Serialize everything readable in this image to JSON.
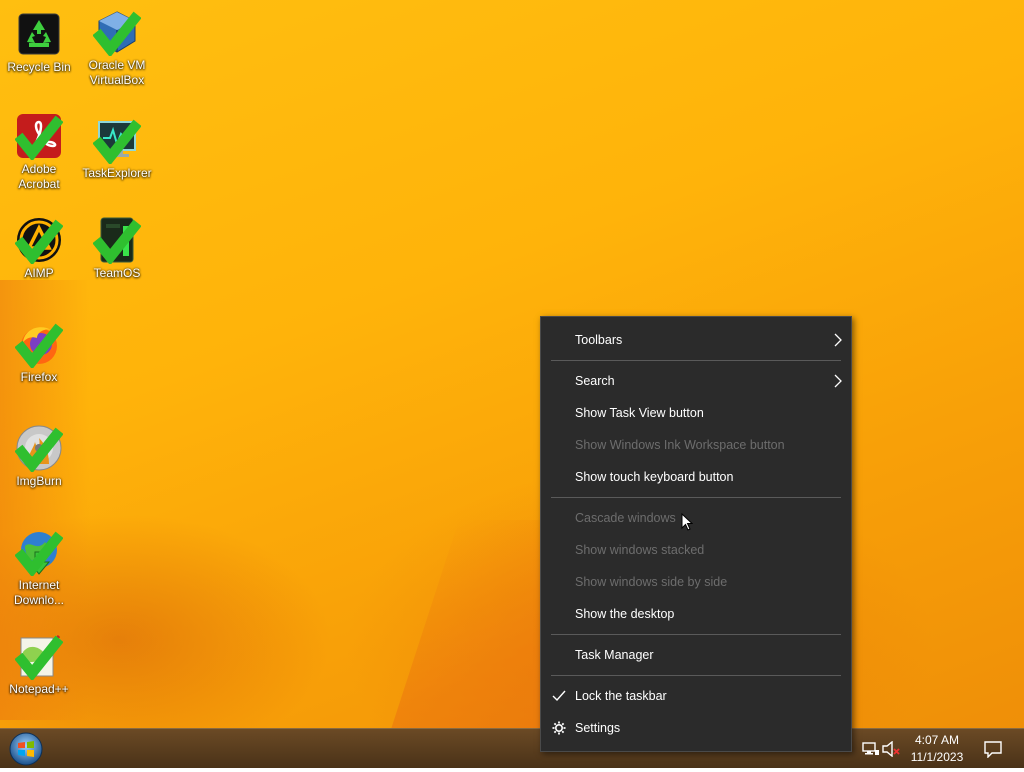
{
  "desktop_icons": [
    {
      "label": "Recycle Bin",
      "icon": "recycle-bin-icon"
    },
    {
      "label": "Oracle VM VirtualBox",
      "icon": "virtualbox-icon"
    },
    {
      "label": "Adobe Acrobat",
      "icon": "acrobat-icon"
    },
    {
      "label": "TaskExplorer",
      "icon": "task-explorer-icon"
    },
    {
      "label": "AIMP",
      "icon": "aimp-icon"
    },
    {
      "label": "TeamOS",
      "icon": "teamos-icon"
    },
    {
      "label": "Firefox",
      "icon": "firefox-icon"
    },
    {
      "label": "ImgBurn",
      "icon": "imgburn-icon"
    },
    {
      "label": "Internet Downlo...",
      "icon": "internet-download-manager-icon"
    },
    {
      "label": "Notepad++",
      "icon": "notepad-plus-plus-icon"
    }
  ],
  "context_menu": {
    "toolbars": "Toolbars",
    "search": "Search",
    "show_task_view": "Show Task View button",
    "show_ink_workspace": "Show Windows Ink Workspace button",
    "show_touch_keyboard": "Show touch keyboard button",
    "cascade_windows": "Cascade windows",
    "show_stacked": "Show windows stacked",
    "show_side_by_side": "Show windows side by side",
    "show_desktop": "Show the desktop",
    "task_manager": "Task Manager",
    "lock_taskbar": "Lock the taskbar",
    "settings": "Settings"
  },
  "taskbar": {
    "time": "4:07 AM",
    "date": "11/1/2023"
  },
  "colors": {
    "menu_bg": "#2b2b2b",
    "menu_disabled_text": "#6d6d6d",
    "desktop_bg": "#ffb30a",
    "taskbar_bg": "#5a3d1e"
  }
}
